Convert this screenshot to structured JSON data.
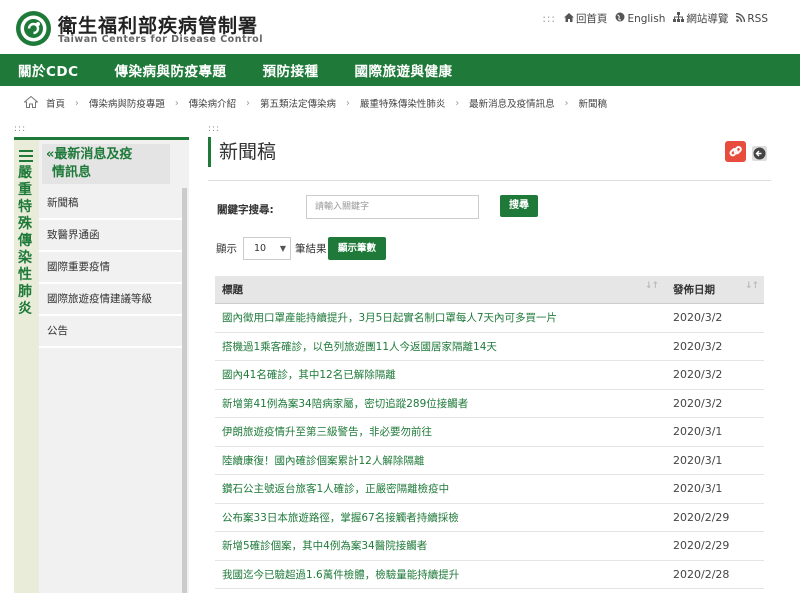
{
  "header": {
    "org_name": "衛生福利部疾病管制署",
    "org_name_en": "Taiwan Centers for Disease Control",
    "toplinks": {
      "dots": ":::",
      "home": "回首頁",
      "english": "English",
      "sitemap": "網站導覽",
      "rss": "RSS"
    }
  },
  "nav": {
    "items": [
      "關於CDC",
      "傳染病與防疫專題",
      "預防接種",
      "國際旅遊與健康"
    ]
  },
  "breadcrumb": {
    "items": [
      "首頁",
      "傳染病與防疫專題",
      "傳染病介紹",
      "第五類法定傳染病",
      "嚴重特殊傳染性肺炎",
      "最新消息及疫情訊息",
      "新聞稿"
    ]
  },
  "sidebar": {
    "dots": ":::",
    "vertical_title": "嚴重特殊傳染性肺炎",
    "section_title_line1": "«最新消息及疫",
    "section_title_line2": "情訊息",
    "items": [
      "新聞稿",
      "致醫界通函",
      "國際重要疫情",
      "國際旅遊疫情建議等級",
      "公告"
    ]
  },
  "main": {
    "dots": ":::",
    "title": "新聞稿",
    "keyword_label": "關鍵字搜尋:",
    "keyword_placeholder": "請輸入關鍵字",
    "search_button": "搜尋",
    "show_label": "顯示",
    "page_size": "10",
    "result_label": "筆結果",
    "show_button": "顯示筆數",
    "table": {
      "headers": [
        "標題",
        "發佈日期"
      ],
      "rows": [
        {
          "title": "國內徵用口罩產能持續提升，3月5日起實名制口罩每人7天內可多買一片",
          "date": "2020/3/2"
        },
        {
          "title": "搭機過1乘客確診，以色列旅遊團11人今返國居家隔離14天",
          "date": "2020/3/2"
        },
        {
          "title": "國內41名確診，其中12名已解除隔離",
          "date": "2020/3/2"
        },
        {
          "title": "新增第41例為案34陪病家屬，密切追蹤289位接觸者",
          "date": "2020/3/2"
        },
        {
          "title": "伊朗旅遊疫情升至第三級警告，非必要勿前往",
          "date": "2020/3/1"
        },
        {
          "title": "陸續康復！國內確診個案累計12人解除隔離",
          "date": "2020/3/1"
        },
        {
          "title": "鑽石公主號返台旅客1人確診，正嚴密隔離檢疫中",
          "date": "2020/3/1"
        },
        {
          "title": "公布案33日本旅遊路徑，掌握67名接觸者持續採檢",
          "date": "2020/2/29"
        },
        {
          "title": "新增5確診個案，其中4例為案34醫院接觸者",
          "date": "2020/2/29"
        },
        {
          "title": "我國迄今已驗超過1.6萬件檢體，檢驗量能持續提升",
          "date": "2020/2/28"
        }
      ]
    }
  },
  "colors": {
    "brand_green": "#1f7a3a",
    "share_red": "#e84c3d"
  }
}
